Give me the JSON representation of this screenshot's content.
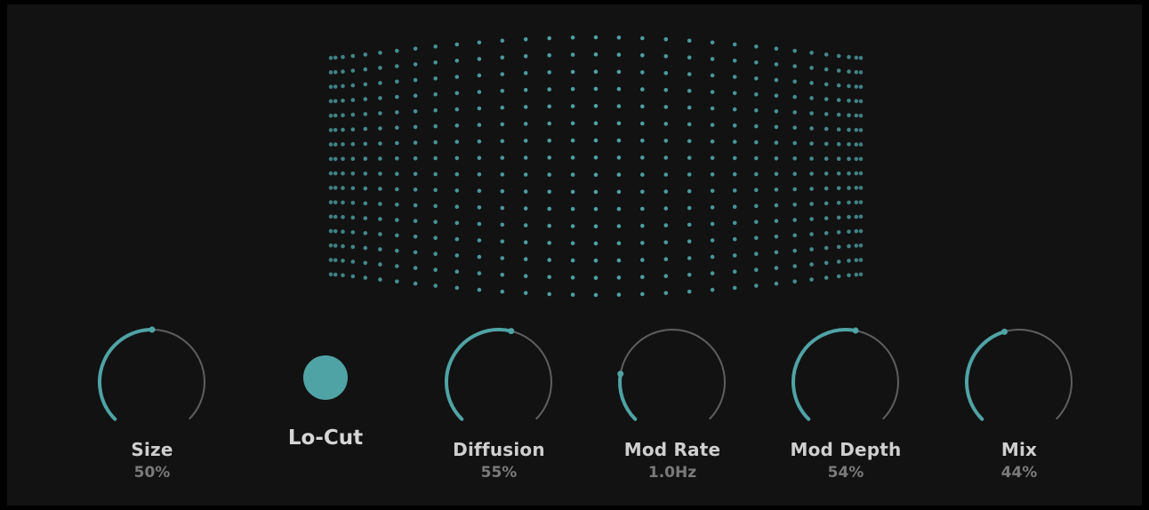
{
  "theme": {
    "background": "#121212",
    "accent": "#4fa3a5",
    "track": "#5e5e5e",
    "label": "#cfcfcf",
    "value": "#7a7a7a"
  },
  "visualizer": {
    "icon": "dot-grid-sphere"
  },
  "locut": {
    "label": "Lo-Cut",
    "enabled": true
  },
  "knobs": [
    {
      "id": "size",
      "label": "Size",
      "value_text": "50%",
      "value": 0.5
    },
    {
      "id": "diffusion",
      "label": "Diffusion",
      "value_text": "55%",
      "value": 0.55
    },
    {
      "id": "mod-rate",
      "label": "Mod Rate",
      "value_text": "1.0Hz",
      "value": 0.2
    },
    {
      "id": "mod-depth",
      "label": "Mod Depth",
      "value_text": "54%",
      "value": 0.54
    },
    {
      "id": "mix",
      "label": "Mix",
      "value_text": "44%",
      "value": 0.44
    }
  ]
}
